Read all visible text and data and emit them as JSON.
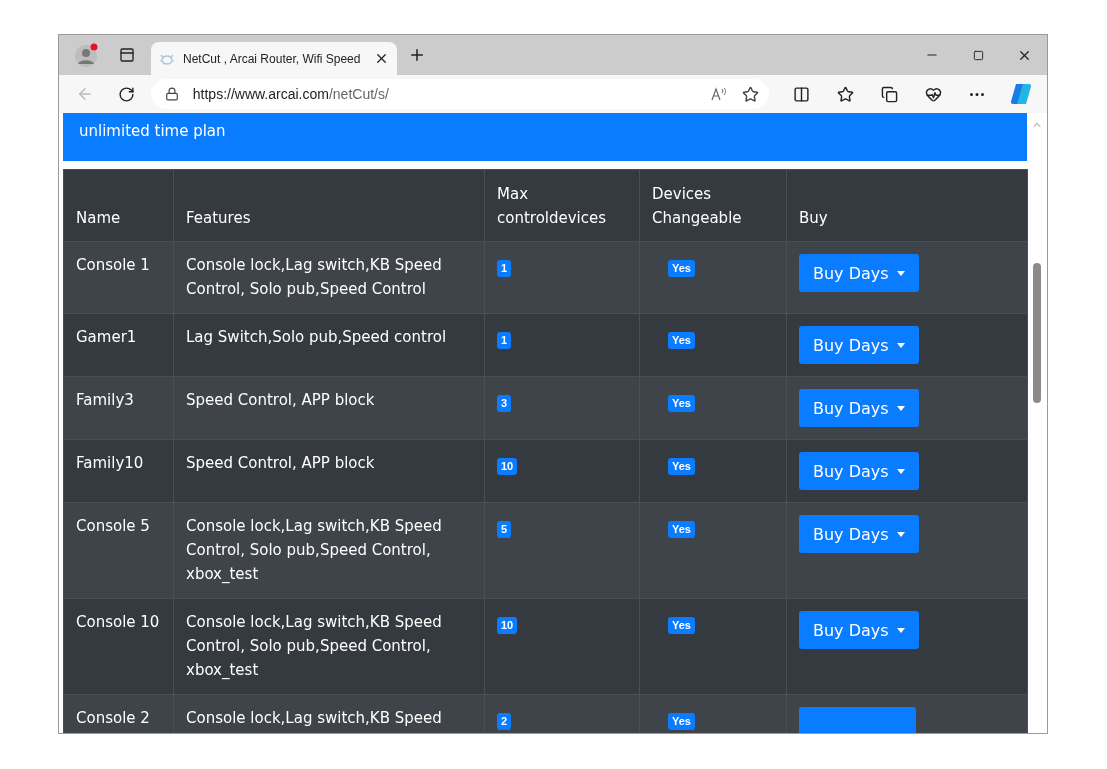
{
  "browser": {
    "tab_title": "NetCut , Arcai Router, Wifi Speed",
    "url_host": "https://www.arcai.com",
    "url_path": "/netCut/s/"
  },
  "plan_title": "unlimited time plan",
  "table": {
    "columns": [
      "Name",
      "Features",
      "Max controldevices",
      "Devices Changeable",
      "Buy"
    ],
    "rows": [
      {
        "name": "Console 1",
        "features": "Console lock,Lag switch,KB Speed Control, Solo pub,Speed Control",
        "max_devices": "1",
        "changeable": "Yes",
        "buy": "Buy Days"
      },
      {
        "name": "Gamer1",
        "features": "Lag Switch,Solo pub,Speed control",
        "max_devices": "1",
        "changeable": "Yes",
        "buy": "Buy Days"
      },
      {
        "name": "Family3",
        "features": "Speed Control, APP block",
        "max_devices": "3",
        "changeable": "Yes",
        "buy": "Buy Days"
      },
      {
        "name": "Family10",
        "features": "Speed Control, APP block",
        "max_devices": "10",
        "changeable": "Yes",
        "buy": "Buy Days"
      },
      {
        "name": "Console 5",
        "features": "Console lock,Lag switch,KB Speed Control, Solo pub,Speed Control, xbox_test",
        "max_devices": "5",
        "changeable": "Yes",
        "buy": "Buy Days"
      },
      {
        "name": "Console 10",
        "features": "Console lock,Lag switch,KB Speed Control, Solo pub,Speed Control, xbox_test",
        "max_devices": "10",
        "changeable": "Yes",
        "buy": "Buy Days"
      },
      {
        "name": "Console 2",
        "features": "Console lock,Lag switch,KB Speed",
        "max_devices": "2",
        "changeable": "Yes"
      }
    ]
  }
}
